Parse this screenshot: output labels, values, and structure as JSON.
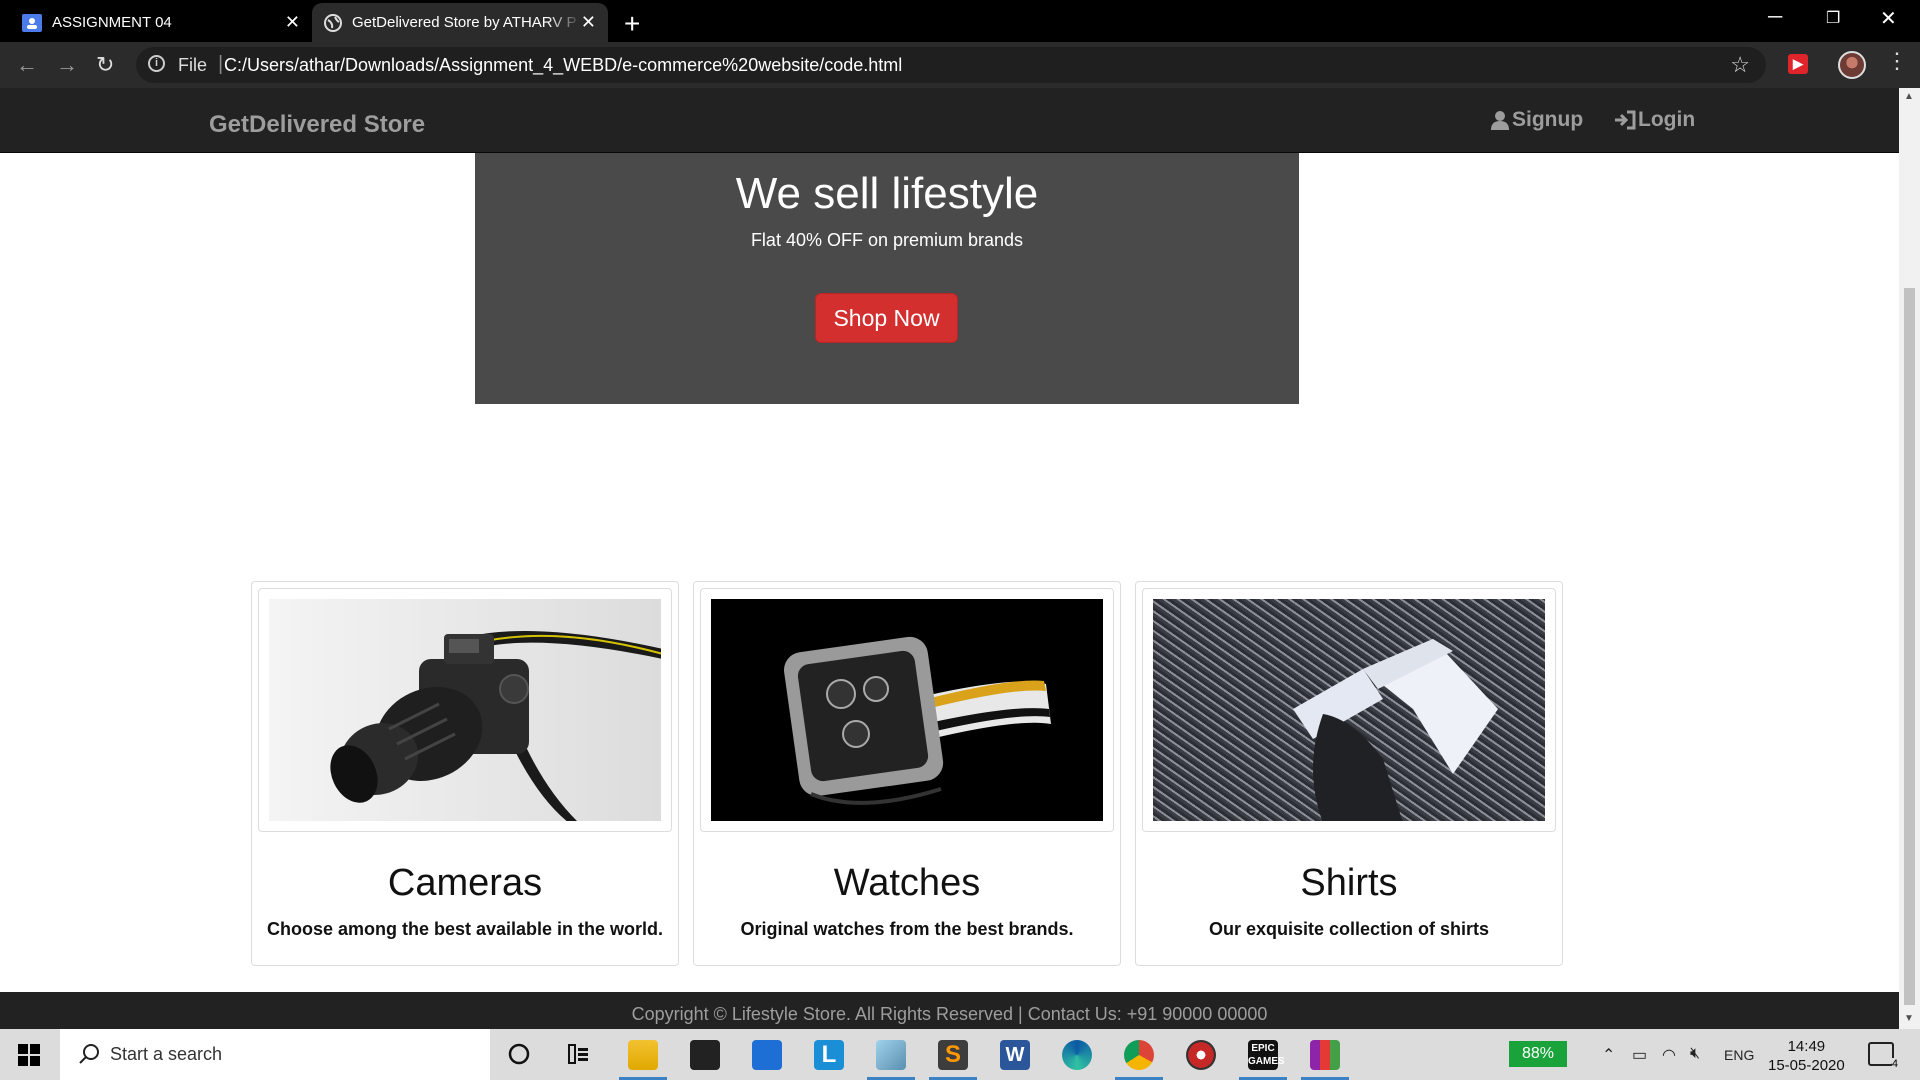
{
  "browser": {
    "tabs": [
      {
        "title": "ASSIGNMENT 04",
        "icon": "classroom-icon",
        "active": false
      },
      {
        "title": "GetDelivered Store by ATHARV P",
        "icon": "globe-icon",
        "active": true
      }
    ],
    "address": {
      "scheme_label": "File",
      "url": "C:/Users/athar/Downloads/Assignment_4_WEBD/e-commerce%20website/code.html"
    }
  },
  "site": {
    "brand": "GetDelivered Store",
    "nav": {
      "signup": "Signup",
      "login": "Login"
    },
    "hero": {
      "title": "We sell lifestyle",
      "subtitle": "Flat 40% OFF on premium brands",
      "button": "Shop Now"
    },
    "products": [
      {
        "title": "Cameras",
        "description": "Choose among the best available in the world."
      },
      {
        "title": "Watches",
        "description": "Original watches from the best brands."
      },
      {
        "title": "Shirts",
        "description": "Our exquisite collection of shirts"
      }
    ],
    "footer": "Copyright © Lifestyle Store. All Rights Reserved | Contact Us: +91 90000 00000"
  },
  "taskbar": {
    "search_placeholder": "Start a search",
    "battery": "88%",
    "language": "ENG",
    "time": "14:49",
    "date": "15-05-2020",
    "notifications": "4"
  },
  "colors": {
    "navbar": "#222222",
    "hero": "#4a4a4a",
    "accent_button": "#d32f2f"
  }
}
